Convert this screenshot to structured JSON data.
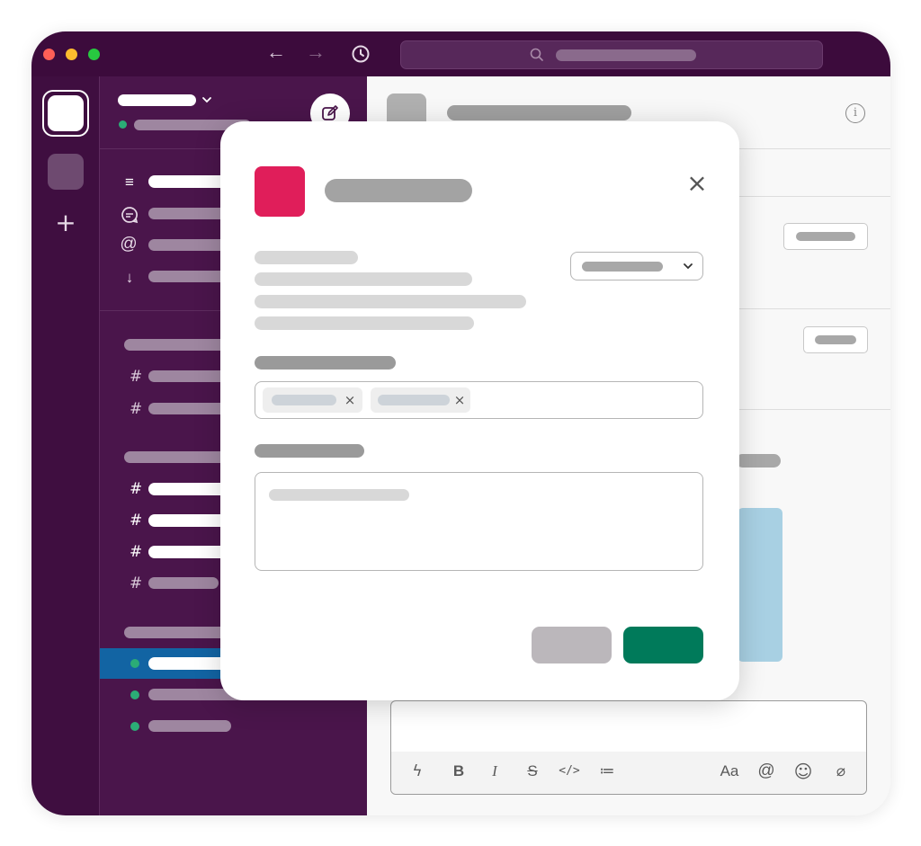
{
  "window": {
    "traffic_lights": {
      "close_color": "#ff5f57",
      "minimize_color": "#febc2e",
      "zoom_color": "#28c840"
    },
    "nav": {
      "back_icon": "←",
      "forward_icon": "→",
      "history_icon": "clock-icon"
    },
    "search": {
      "icon": "search-icon"
    }
  },
  "rail": {
    "add_icon": "+"
  },
  "sidebar": {
    "compose_icon": "compose-icon",
    "nav_items": [
      {
        "icon": "≡",
        "name": "threads"
      },
      {
        "icon": "💬",
        "name": "dms"
      },
      {
        "icon": "@",
        "name": "mentions"
      },
      {
        "icon": "↓",
        "name": "saved"
      }
    ],
    "channel_hash": "#",
    "active_color": "#1264a3",
    "presence_color": "#2bac76"
  },
  "main": {
    "info_icon": "i",
    "composer_tools": [
      {
        "name": "shortcuts-icon",
        "glyph": "ϟ"
      },
      {
        "name": "bold-icon",
        "glyph": "B"
      },
      {
        "name": "italic-icon",
        "glyph": "I"
      },
      {
        "name": "strikethrough-icon",
        "glyph": "S"
      },
      {
        "name": "code-icon",
        "glyph": "</>"
      },
      {
        "name": "list-icon",
        "glyph": "≔"
      },
      {
        "name": "format-icon",
        "glyph": "Aa"
      },
      {
        "name": "mention-icon",
        "glyph": "@"
      },
      {
        "name": "emoji-icon",
        "glyph": "☺"
      },
      {
        "name": "attach-icon",
        "glyph": "⌀"
      }
    ]
  },
  "modal": {
    "app_color": "#e01e5a",
    "close_icon": "×",
    "chip_remove_icon": "×",
    "submit_color": "#007a5a",
    "cancel_color": "#bbb7bb"
  }
}
